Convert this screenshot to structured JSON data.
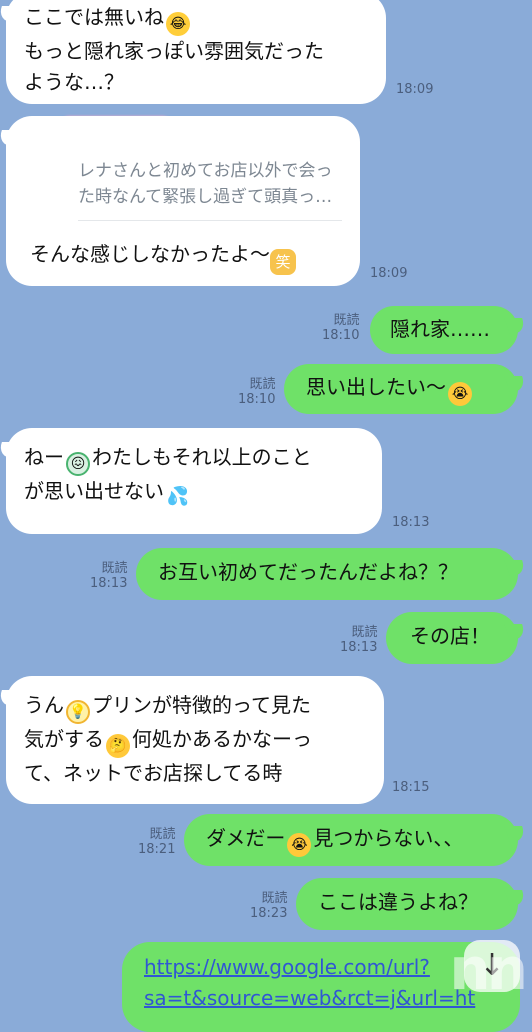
{
  "messages": {
    "m1": {
      "line1": "ここでは無いね",
      "line2": "もっと隠れ家っぽい雰囲気だった",
      "line3": "ような…？",
      "time": "18:09"
    },
    "m2": {
      "quote_line1": "レナさんと初めてお店以外で会っ",
      "quote_line2": "た時なんて緊張し過ぎて頭真っ…",
      "text": "そんな感じしなかったよ〜",
      "time": "18:09"
    },
    "m3": {
      "text": "隠れ家……",
      "read": "既読",
      "time": "18:10"
    },
    "m4": {
      "text": "思い出したい〜",
      "read": "既読",
      "time": "18:10"
    },
    "m5": {
      "line1_a": "ねー",
      "line1_b": "わたしもそれ以上のこと",
      "line2": "が思い出せない",
      "time": "18:13"
    },
    "m6": {
      "text": "お互い初めてだったんだよね？？",
      "read": "既読",
      "time": "18:13"
    },
    "m7": {
      "text": "その店！",
      "read": "既読",
      "time": "18:13"
    },
    "m8": {
      "line1_a": "うん",
      "line1_b": "プリンが特徴的って見た",
      "line2_a": "気がする",
      "line2_b": "何処かあるかなーっ",
      "line3": "て、ネットでお店探してる時",
      "time": "18:15"
    },
    "m9": {
      "text_a": "ダメだー",
      "text_b": "見つからない、、",
      "read": "既読",
      "time": "18:21"
    },
    "m10": {
      "text": "ここは違うよね？",
      "read": "既読",
      "time": "18:23"
    },
    "m11": {
      "line1": "https://www.google.com/url?",
      "line2": "sa=t&source=web&rct=j&url=ht"
    }
  },
  "icons": {
    "laugh": "rolling-laugh-emoji",
    "cry": "crying-emoji",
    "sweat": "sweat-face-emoji",
    "drops": "sweat-drops-emoji",
    "bulb": "lightbulb-emoji",
    "think": "thinking-emoji",
    "smile": "laugh-badge-emoji",
    "down": "scroll-down-arrow-icon"
  },
  "emoji_glyphs": {
    "laugh": "😂",
    "cry": "😭",
    "sweat": "😖",
    "drops": "💦",
    "bulb": "💡",
    "think": "🤔",
    "smile": "笑",
    "down": "↓"
  },
  "watermark": "nn"
}
